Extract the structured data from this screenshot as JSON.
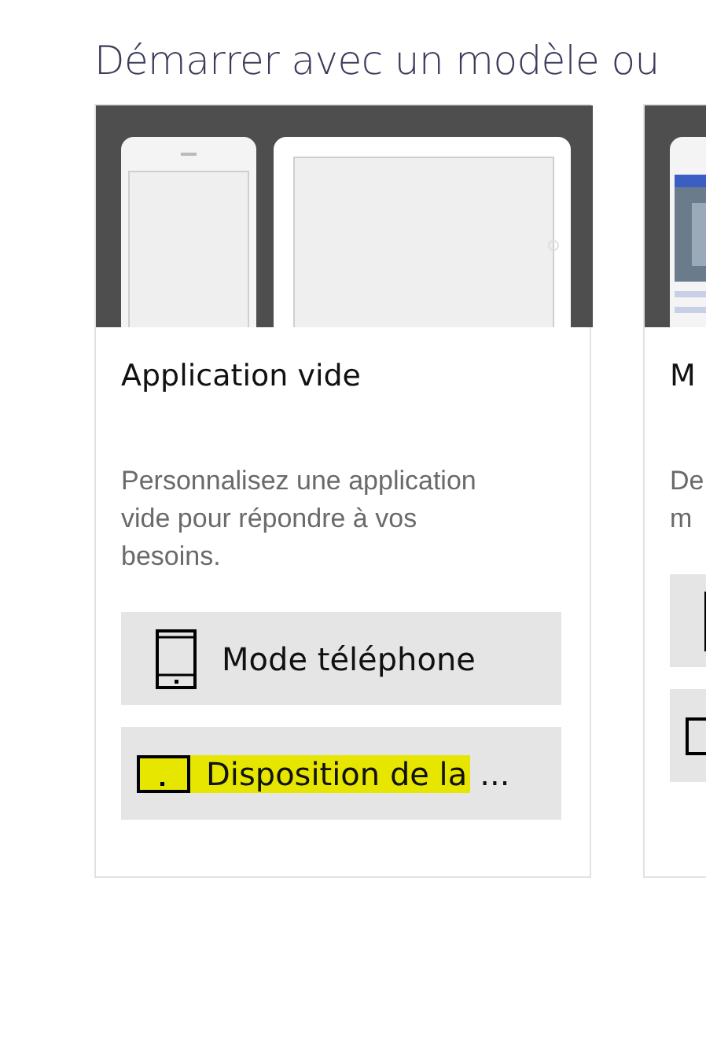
{
  "heading": "Démarrer avec un modèle ou",
  "cards": [
    {
      "kind": "devices",
      "title": "Application vide",
      "description_lines": [
        "Personnalisez une application",
        "vide pour répondre à vos",
        "besoins."
      ],
      "buttons": [
        {
          "kind": "phone",
          "label": "Mode téléphone",
          "highlighted": false
        },
        {
          "kind": "tablet",
          "label": "Disposition de la",
          "suffix": "...",
          "highlighted": true
        }
      ]
    },
    {
      "kind": "picture",
      "title": "M",
      "description_lines": [
        "De",
        "m"
      ],
      "buttons": [
        {
          "kind": "phone"
        },
        {
          "kind": "tablet"
        }
      ]
    }
  ]
}
